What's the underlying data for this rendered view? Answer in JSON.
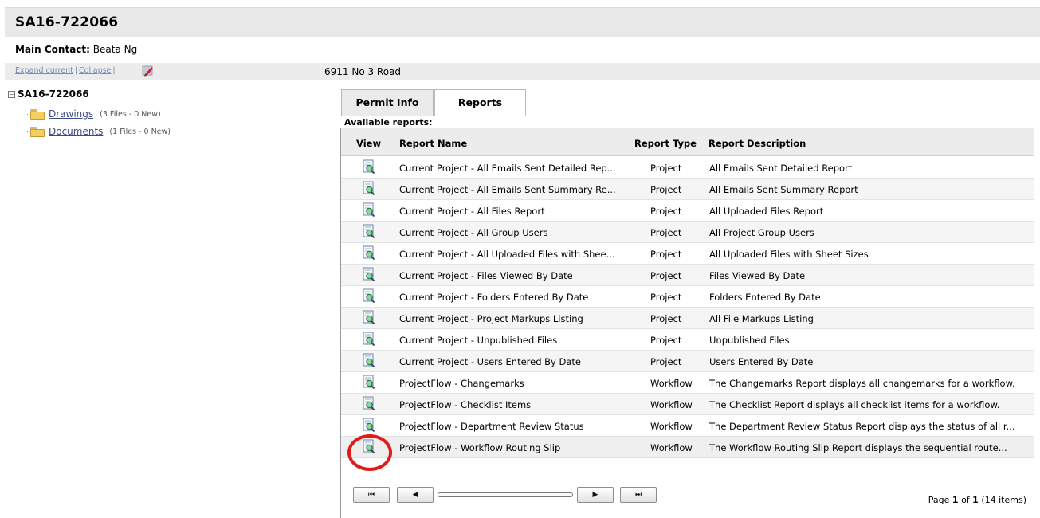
{
  "header": {
    "title": "SA16-722066"
  },
  "contact": {
    "label": "Main Contact:",
    "name": "Beata Ng"
  },
  "toolbar": {
    "expand_label": "Expand current",
    "collapse_label": "Collapse",
    "address": "6911 No 3 Road",
    "edit_icon": "pencil-icon"
  },
  "tree": {
    "root": "SA16-722066",
    "toggle": "−",
    "nodes": [
      {
        "label": "Drawings",
        "meta": "(3 Files - 0 New)"
      },
      {
        "label": "Documents",
        "meta": "(1 Files - 0 New)"
      }
    ]
  },
  "tabs": [
    {
      "label": "Permit Info",
      "selected": false
    },
    {
      "label": "Reports",
      "selected": true
    }
  ],
  "available_label": "Available reports:",
  "columns": {
    "view": "View",
    "name": "Report Name",
    "type": "Report Type",
    "desc": "Report Description"
  },
  "rows": [
    {
      "name": "Current Project - All Emails Sent Detailed Rep...",
      "type": "Project",
      "desc": "All Emails Sent Detailed Report"
    },
    {
      "name": "Current Project - All Emails Sent Summary Re...",
      "type": "Project",
      "desc": "All Emails Sent Summary Report"
    },
    {
      "name": "Current Project - All Files Report",
      "type": "Project",
      "desc": "All Uploaded Files Report"
    },
    {
      "name": "Current Project - All Group Users",
      "type": "Project",
      "desc": "All Project Group Users"
    },
    {
      "name": "Current Project - All Uploaded Files with Shee...",
      "type": "Project",
      "desc": "All Uploaded Files with Sheet Sizes"
    },
    {
      "name": "Current Project - Files Viewed By Date",
      "type": "Project",
      "desc": "Files Viewed By Date"
    },
    {
      "name": "Current Project - Folders Entered By Date",
      "type": "Project",
      "desc": "Folders Entered By Date"
    },
    {
      "name": "Current Project - Project Markups Listing",
      "type": "Project",
      "desc": "All File Markups Listing"
    },
    {
      "name": "Current Project - Unpublished Files",
      "type": "Project",
      "desc": "Unpublished Files"
    },
    {
      "name": "Current Project - Users Entered By Date",
      "type": "Project",
      "desc": "Users Entered By Date"
    },
    {
      "name": "ProjectFlow - Changemarks",
      "type": "Workflow",
      "desc": "The Changemarks Report displays all changemarks for a workflow."
    },
    {
      "name": "ProjectFlow - Checklist Items",
      "type": "Workflow",
      "desc": "The Checklist Report displays all checklist items for a workflow."
    },
    {
      "name": "ProjectFlow - Department Review Status",
      "type": "Workflow",
      "desc": "The Department Review Status Report displays the status of all r..."
    },
    {
      "name": "ProjectFlow - Workflow Routing Slip",
      "type": "Workflow",
      "desc": "The Workflow Routing Slip Report displays the sequential route..."
    }
  ],
  "pager": {
    "first": "⏮",
    "prev": "◀",
    "next": "▶",
    "last": "⏭",
    "page_prefix": "Page",
    "page": "1",
    "of": "of",
    "total_pages": "1",
    "items": "(14 items)"
  }
}
